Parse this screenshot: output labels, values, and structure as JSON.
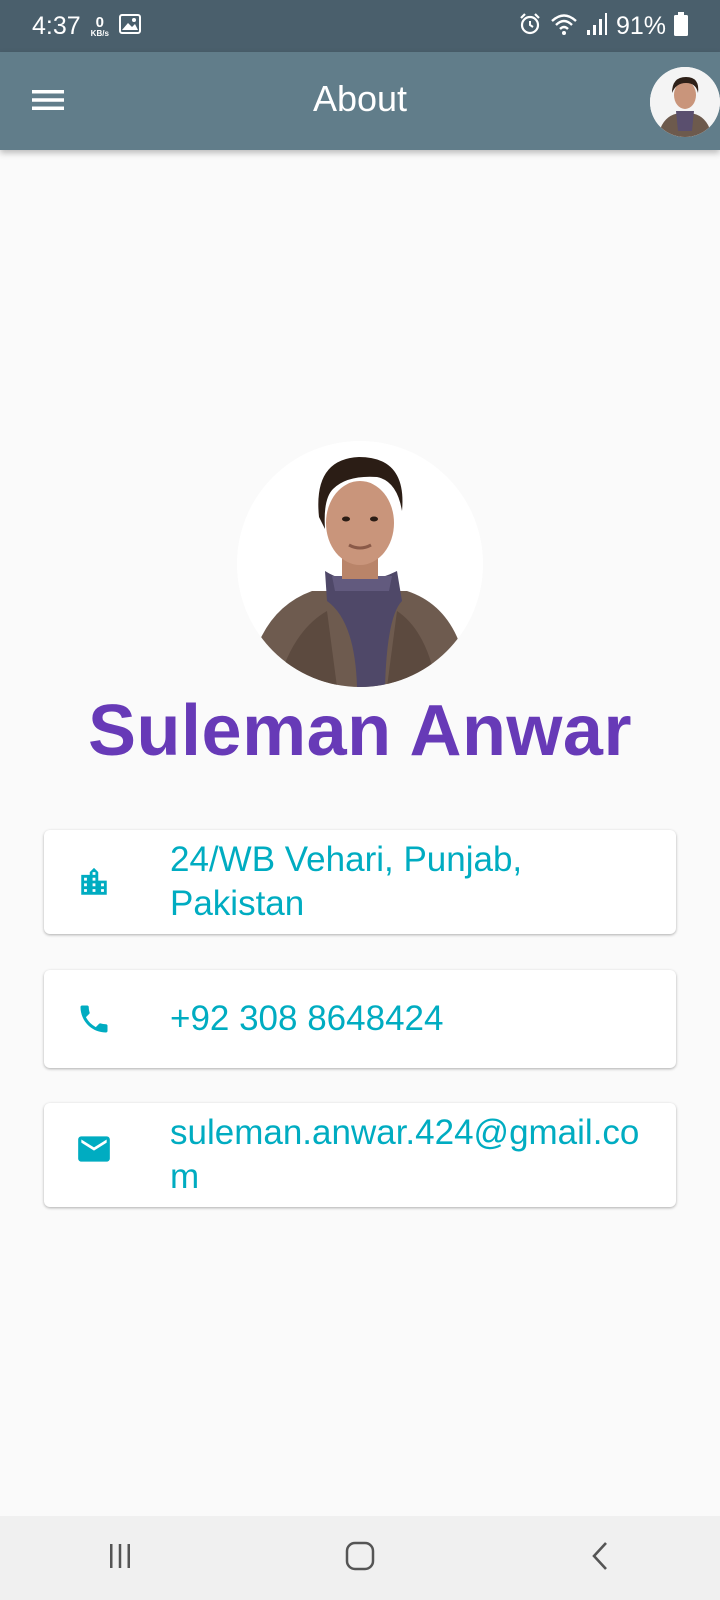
{
  "status_bar": {
    "time": "4:37",
    "net_speed_value": "0",
    "net_speed_unit": "KB/s",
    "battery_percent": "91%",
    "icons": [
      "image-icon",
      "alarm-icon",
      "wifi-icon",
      "signal-icon",
      "battery-icon"
    ]
  },
  "app_bar": {
    "title": "About",
    "menu_icon": "hamburger-menu-icon",
    "avatar": "profile-avatar"
  },
  "profile": {
    "name": "Suleman Anwar"
  },
  "contacts": {
    "address": "24/WB Vehari, Punjab, Pakistan",
    "phone": "+92 308 8648424",
    "email": "suleman.anwar.424@gmail.com"
  },
  "colors": {
    "status_bar": "#4a5f6c",
    "app_bar": "#617d8a",
    "name": "#673ab7",
    "accent": "#00acc1",
    "background": "#fafafa"
  },
  "nav_bar": {
    "icons": [
      "recent-apps-icon",
      "home-icon",
      "back-icon"
    ]
  }
}
